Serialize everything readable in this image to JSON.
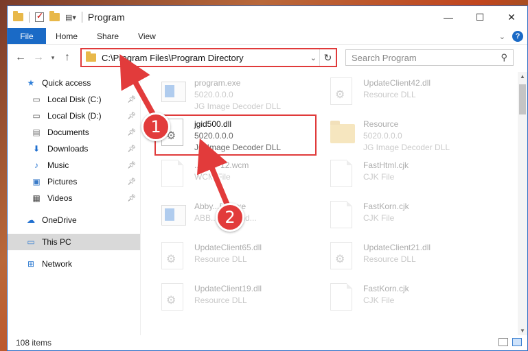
{
  "window": {
    "title": "Program"
  },
  "controls": {
    "minimize": "—",
    "maximize": "☐",
    "close": "✕"
  },
  "ribbon": {
    "tabs": [
      "File",
      "Home",
      "Share",
      "View"
    ],
    "help": "?"
  },
  "address": {
    "path": "C:\\Program Files\\Program Directory",
    "refresh": "↻"
  },
  "search": {
    "placeholder": "Search Program",
    "icon": "search-icon"
  },
  "nav": {
    "items": [
      {
        "label": "Quick access",
        "icon": "star-icon",
        "pinned": false
      },
      {
        "label": "Local Disk (C:)",
        "icon": "drive-icon",
        "pinned": true
      },
      {
        "label": "Local Disk (D:)",
        "icon": "drive-icon",
        "pinned": true
      },
      {
        "label": "Documents",
        "icon": "documents-icon",
        "pinned": true
      },
      {
        "label": "Downloads",
        "icon": "downloads-icon",
        "pinned": true
      },
      {
        "label": "Music",
        "icon": "music-icon",
        "pinned": true
      },
      {
        "label": "Pictures",
        "icon": "pictures-icon",
        "pinned": true
      },
      {
        "label": "Videos",
        "icon": "videos-icon",
        "pinned": true
      },
      {
        "label": "OneDrive",
        "icon": "cloud-icon"
      },
      {
        "label": "This PC",
        "icon": "computer-icon",
        "selected": true
      },
      {
        "label": "Network",
        "icon": "network-icon"
      }
    ]
  },
  "files": [
    {
      "name": "program.exe",
      "line2": "5020.0.0.0",
      "line3": "JG Image Decoder DLL",
      "icon": "exe-icon",
      "faded": true
    },
    {
      "name": "UpdateClient42.dll",
      "line2": "Resource DLL",
      "line3": "",
      "icon": "dll-icon",
      "faded": true
    },
    {
      "name": "jgid500.dll",
      "line2": "5020.0.0.0",
      "line3": "JG Image Decoder DLL",
      "icon": "dll-icon",
      "faded": false
    },
    {
      "name": "Resource",
      "line2": "5020.0.0.0",
      "line3": "JG Image Decoder DLL",
      "icon": "folder-icon",
      "faded": true
    },
    {
      "name": "...00dP12.wcm",
      "line2": "WCM File",
      "line3": "",
      "icon": "doc-icon",
      "faded": true
    },
    {
      "name": "FastHtml.cjk",
      "line2": "CJK File",
      "line3": "",
      "icon": "doc-icon",
      "faded": true
    },
    {
      "name": "Abby...BB.exe",
      "line2": "ABB...ent hand...",
      "line3": "",
      "icon": "exe-icon",
      "faded": true
    },
    {
      "name": "FastKorn.cjk",
      "line2": "CJK File",
      "line3": "",
      "icon": "doc-icon",
      "faded": true
    },
    {
      "name": "UpdateClient65.dll",
      "line2": "Resource DLL",
      "line3": "",
      "icon": "dll-icon",
      "faded": true
    },
    {
      "name": "UpdateClient21.dll",
      "line2": "Resource DLL",
      "line3": "",
      "icon": "dll-icon",
      "faded": true
    },
    {
      "name": "UpdateClient19.dll",
      "line2": "Resource DLL",
      "line3": "",
      "icon": "dll-icon",
      "faded": true
    },
    {
      "name": "FastKorn.cjk",
      "line2": "CJK File",
      "line3": "",
      "icon": "doc-icon",
      "faded": true
    }
  ],
  "status": {
    "count": "108 items"
  },
  "annotations": {
    "step1": "1",
    "step2": "2",
    "color": "#e23b3b"
  }
}
